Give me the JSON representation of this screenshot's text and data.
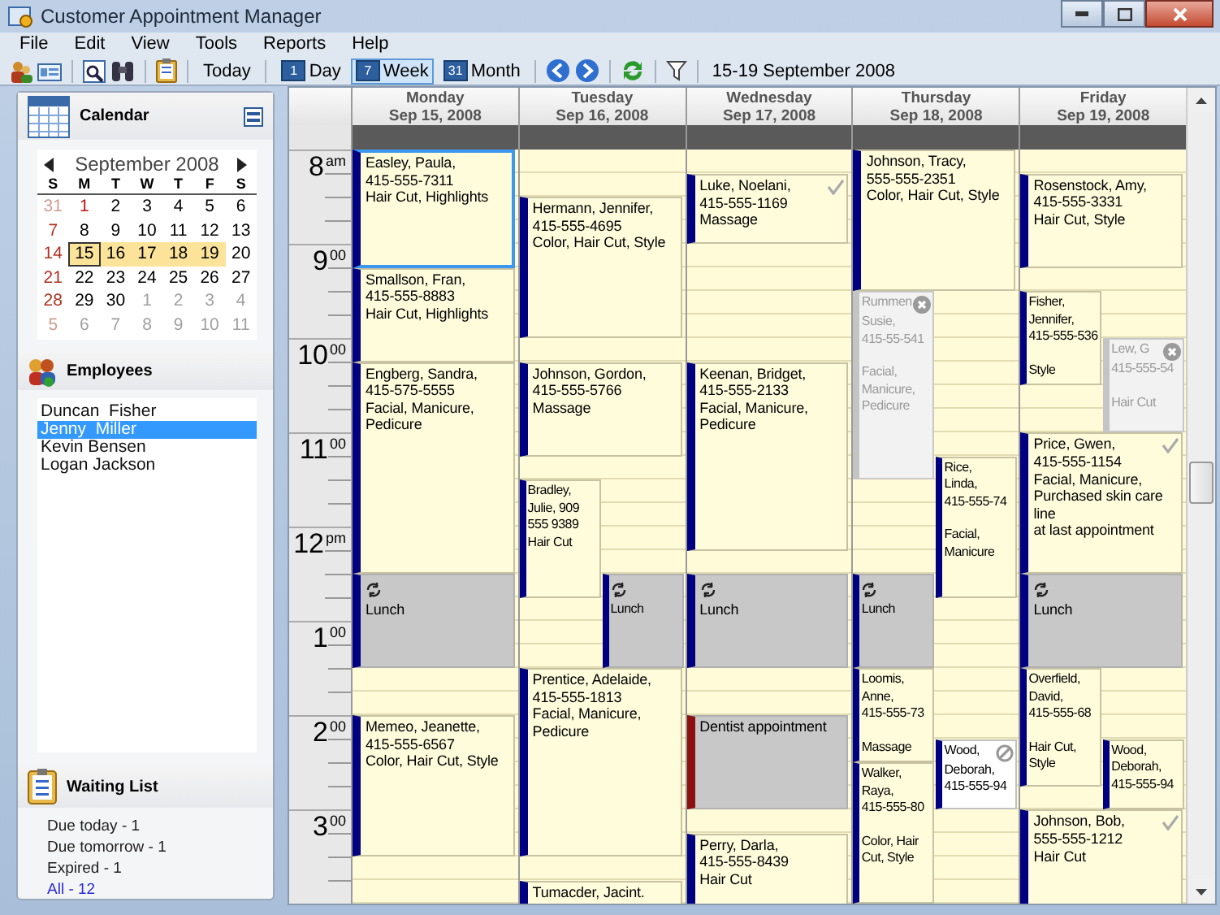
{
  "window": {
    "title": "Customer Appointment Manager"
  },
  "menu": [
    "File",
    "Edit",
    "View",
    "Tools",
    "Reports",
    "Help"
  ],
  "toolbar": {
    "today": "Today",
    "views": [
      {
        "label": "Day",
        "badge": "1",
        "selected": false
      },
      {
        "label": "Week",
        "badge": "7",
        "selected": true
      },
      {
        "label": "Month",
        "badge": "31",
        "selected": false
      }
    ],
    "range": "15-19 September 2008"
  },
  "calendar_panel": {
    "title": "Calendar",
    "month": "September 2008",
    "weekdays": [
      "S",
      "M",
      "T",
      "W",
      "T",
      "F",
      "S"
    ],
    "weeks": [
      [
        {
          "day": "31",
          "kind": "other",
          "selected": false,
          "today": false
        },
        {
          "day": "1",
          "kind": "holiday",
          "selected": false,
          "today": false
        },
        {
          "day": "2",
          "kind": "day",
          "selected": false,
          "today": false
        },
        {
          "day": "3",
          "kind": "day",
          "selected": false,
          "today": false
        },
        {
          "day": "4",
          "kind": "day",
          "selected": false,
          "today": false
        },
        {
          "day": "5",
          "kind": "day",
          "selected": false,
          "today": false
        },
        {
          "day": "6",
          "kind": "day",
          "selected": false,
          "today": false
        }
      ],
      [
        {
          "day": "7",
          "kind": "day",
          "selected": false,
          "today": false
        },
        {
          "day": "8",
          "kind": "day",
          "selected": false,
          "today": false
        },
        {
          "day": "9",
          "kind": "day",
          "selected": false,
          "today": false
        },
        {
          "day": "10",
          "kind": "day",
          "selected": false,
          "today": false
        },
        {
          "day": "11",
          "kind": "day",
          "selected": false,
          "today": false
        },
        {
          "day": "12",
          "kind": "day",
          "selected": false,
          "today": false
        },
        {
          "day": "13",
          "kind": "day",
          "selected": false,
          "today": false
        }
      ],
      [
        {
          "day": "14",
          "kind": "day",
          "selected": false,
          "today": false
        },
        {
          "day": "15",
          "kind": "day",
          "selected": true,
          "today": true
        },
        {
          "day": "16",
          "kind": "day",
          "selected": true,
          "today": false
        },
        {
          "day": "17",
          "kind": "day",
          "selected": true,
          "today": false
        },
        {
          "day": "18",
          "kind": "day",
          "selected": true,
          "today": false
        },
        {
          "day": "19",
          "kind": "day",
          "selected": true,
          "today": false
        },
        {
          "day": "20",
          "kind": "day",
          "selected": false,
          "today": false
        }
      ],
      [
        {
          "day": "21",
          "kind": "day",
          "selected": false,
          "today": false
        },
        {
          "day": "22",
          "kind": "day",
          "selected": false,
          "today": false
        },
        {
          "day": "23",
          "kind": "day",
          "selected": false,
          "today": false
        },
        {
          "day": "24",
          "kind": "day",
          "selected": false,
          "today": false
        },
        {
          "day": "25",
          "kind": "day",
          "selected": false,
          "today": false
        },
        {
          "day": "26",
          "kind": "day",
          "selected": false,
          "today": false
        },
        {
          "day": "27",
          "kind": "day",
          "selected": false,
          "today": false
        }
      ],
      [
        {
          "day": "28",
          "kind": "day",
          "selected": false,
          "today": false
        },
        {
          "day": "29",
          "kind": "day",
          "selected": false,
          "today": false
        },
        {
          "day": "30",
          "kind": "day",
          "selected": false,
          "today": false
        },
        {
          "day": "1",
          "kind": "other",
          "selected": false,
          "today": false
        },
        {
          "day": "2",
          "kind": "other",
          "selected": false,
          "today": false
        },
        {
          "day": "3",
          "kind": "other",
          "selected": false,
          "today": false
        },
        {
          "day": "4",
          "kind": "other",
          "selected": false,
          "today": false
        }
      ],
      [
        {
          "day": "5",
          "kind": "other",
          "selected": false,
          "today": false
        },
        {
          "day": "6",
          "kind": "other",
          "selected": false,
          "today": false
        },
        {
          "day": "7",
          "kind": "other",
          "selected": false,
          "today": false
        },
        {
          "day": "8",
          "kind": "other",
          "selected": false,
          "today": false
        },
        {
          "day": "9",
          "kind": "other",
          "selected": false,
          "today": false
        },
        {
          "day": "10",
          "kind": "other",
          "selected": false,
          "today": false
        },
        {
          "day": "11",
          "kind": "other",
          "selected": false,
          "today": false
        }
      ]
    ]
  },
  "employees": {
    "title": "Employees",
    "items": [
      {
        "name": "Duncan  Fisher",
        "selected": false
      },
      {
        "name": "Jenny  Miller",
        "selected": true
      },
      {
        "name": "Kevin Bensen",
        "selected": false
      },
      {
        "name": "Logan Jackson",
        "selected": false
      }
    ]
  },
  "waiting_list": {
    "title": "Waiting List",
    "items": [
      {
        "label": "Due today - 1",
        "kind": "text"
      },
      {
        "label": "Due tomorrow - 1",
        "kind": "text"
      },
      {
        "label": "Expired - 1",
        "kind": "text"
      },
      {
        "label": "All - 12",
        "kind": "link"
      }
    ]
  },
  "schedule": {
    "times": [
      {
        "hour": "8",
        "suffix": "am"
      },
      {
        "hour": "9",
        "suffix": "00"
      },
      {
        "hour": "10",
        "suffix": "00"
      },
      {
        "hour": "11",
        "suffix": "00"
      },
      {
        "hour": "12",
        "suffix": "pm"
      },
      {
        "hour": "1",
        "suffix": "00"
      },
      {
        "hour": "2",
        "suffix": "00"
      },
      {
        "hour": "3",
        "suffix": "00"
      }
    ],
    "days": [
      {
        "name": "Monday",
        "date": "Sep 15, 2008",
        "appointments": [
          {
            "kind": "booked",
            "selected": true,
            "checked": false,
            "lines": [
              "Easley, Paula,",
              "415-555-7311",
              "Hair Cut, Highlights"
            ]
          },
          {
            "kind": "booked",
            "selected": false,
            "checked": false,
            "lines": [
              "Smallson, Fran,",
              "415-555-8883",
              "Hair Cut, Highlights"
            ]
          },
          {
            "kind": "booked",
            "selected": false,
            "checked": false,
            "lines": [
              "Engberg, Sandra,",
              "415-575-5555",
              "Facial, Manicure, Pedicure"
            ]
          },
          {
            "kind": "recurring",
            "selected": false,
            "checked": false,
            "lines": [
              "Lunch"
            ]
          },
          {
            "kind": "booked",
            "selected": false,
            "checked": false,
            "lines": [
              "Memeo, Jeanette,",
              "415-555-6567",
              "Color, Hair Cut, Style"
            ]
          }
        ]
      },
      {
        "name": "Tuesday",
        "date": "Sep 16, 2008",
        "appointments": [
          {
            "kind": "booked",
            "selected": false,
            "checked": false,
            "lines": [
              "Hermann, Jennifer,",
              "415-555-4695",
              "Color, Hair Cut, Style"
            ]
          },
          {
            "kind": "booked",
            "selected": false,
            "checked": false,
            "lines": [
              "Johnson, Gordon,",
              "415-555-5766",
              "Massage"
            ]
          },
          {
            "kind": "booked",
            "selected": false,
            "checked": false,
            "lines": [
              "Bradley,",
              "Julie, 909",
              "555 9389",
              "Hair Cut"
            ]
          },
          {
            "kind": "recurring",
            "selected": false,
            "checked": false,
            "lines": [
              "Lunch"
            ]
          },
          {
            "kind": "booked",
            "selected": false,
            "checked": false,
            "lines": [
              "Prentice, Adelaide,",
              "415-555-1813",
              "Facial, Manicure,",
              "Pedicure"
            ]
          },
          {
            "kind": "booked",
            "selected": false,
            "checked": false,
            "lines": [
              "Tumacder, Jacint."
            ]
          }
        ]
      },
      {
        "name": "Wednesday",
        "date": "Sep 17, 2008",
        "appointments": [
          {
            "kind": "booked",
            "selected": false,
            "checked": true,
            "lines": [
              "Luke, Noelani,",
              "415-555-1169",
              "Massage"
            ]
          },
          {
            "kind": "booked",
            "selected": false,
            "checked": false,
            "lines": [
              "Keenan, Bridget,",
              "415-555-2133",
              "Facial, Manicure, Pedicure"
            ]
          },
          {
            "kind": "recurring",
            "selected": false,
            "checked": false,
            "lines": [
              "Lunch"
            ]
          },
          {
            "kind": "personal",
            "selected": false,
            "checked": false,
            "lines": [
              "Dentist appointment"
            ]
          },
          {
            "kind": "booked",
            "selected": false,
            "checked": false,
            "lines": [
              "Perry, Darla,",
              "415-555-8439",
              "Hair Cut"
            ]
          }
        ]
      },
      {
        "name": "Thursday",
        "date": "Sep 18, 2008",
        "appointments": [
          {
            "kind": "booked",
            "selected": false,
            "checked": false,
            "lines": [
              "Johnson, Tracy,",
              "555-555-2351",
              "Color, Hair Cut, Style"
            ]
          },
          {
            "kind": "cancelled",
            "selected": false,
            "checked": false,
            "lines": [
              "Rummen",
              "Susie,",
              "415-55-541"
            ],
            "details": [
              "Facial,",
              "Manicure,",
              "Pedicure"
            ]
          },
          {
            "kind": "booked",
            "selected": false,
            "checked": false,
            "lines": [
              "Rice,",
              "Linda,",
              "415-555-74"
            ],
            "details": [
              "Facial,",
              "Manicure"
            ]
          },
          {
            "kind": "recurring",
            "selected": false,
            "checked": false,
            "lines": [
              "Lunch"
            ]
          },
          {
            "kind": "booked",
            "selected": false,
            "checked": false,
            "lines": [
              "Loomis,",
              "Anne,",
              "415-555-73"
            ],
            "details": [
              "Massage"
            ]
          },
          {
            "kind": "booked",
            "selected": false,
            "checked": false,
            "lines": [
              "Walker,",
              "Raya,",
              "415-555-80"
            ],
            "details": [
              "Color, Hair",
              "Cut, Style"
            ]
          },
          {
            "kind": "blocked",
            "selected": false,
            "checked": false,
            "lines": [
              "Wood,",
              "Deborah,",
              "415-555-94"
            ]
          }
        ]
      },
      {
        "name": "Friday",
        "date": "Sep 19, 2008",
        "appointments": [
          {
            "kind": "booked",
            "selected": false,
            "checked": false,
            "lines": [
              "Rosenstock, Amy,",
              "415-555-3331",
              "Hair Cut, Style"
            ]
          },
          {
            "kind": "booked",
            "selected": false,
            "checked": false,
            "lines": [
              "Fisher,",
              "Jennifer,",
              "415-555-536"
            ],
            "details": [
              "Style"
            ]
          },
          {
            "kind": "cancelled",
            "selected": false,
            "checked": false,
            "lines": [
              "Lew, G",
              "415-555-54"
            ],
            "details": [
              "Hair Cut"
            ]
          },
          {
            "kind": "booked",
            "selected": false,
            "checked": true,
            "lines": [
              "Price, Gwen,",
              "415-555-1154",
              "Facial, Manicure,",
              "Purchased skin care line",
              "at last appointment"
            ]
          },
          {
            "kind": "recurring",
            "selected": false,
            "checked": false,
            "lines": [
              "Lunch"
            ]
          },
          {
            "kind": "booked",
            "selected": false,
            "checked": false,
            "lines": [
              "Overfield,",
              "David,",
              "415-555-68"
            ],
            "details": [
              "Hair Cut,",
              "Style"
            ]
          },
          {
            "kind": "booked",
            "selected": false,
            "checked": false,
            "lines": [
              "Wood,",
              "Deborah,",
              "415-555-94"
            ]
          },
          {
            "kind": "booked",
            "selected": false,
            "checked": true,
            "lines": [
              "Johnson, Bob,",
              "555-555-1212",
              "Hair Cut"
            ]
          }
        ]
      }
    ]
  }
}
